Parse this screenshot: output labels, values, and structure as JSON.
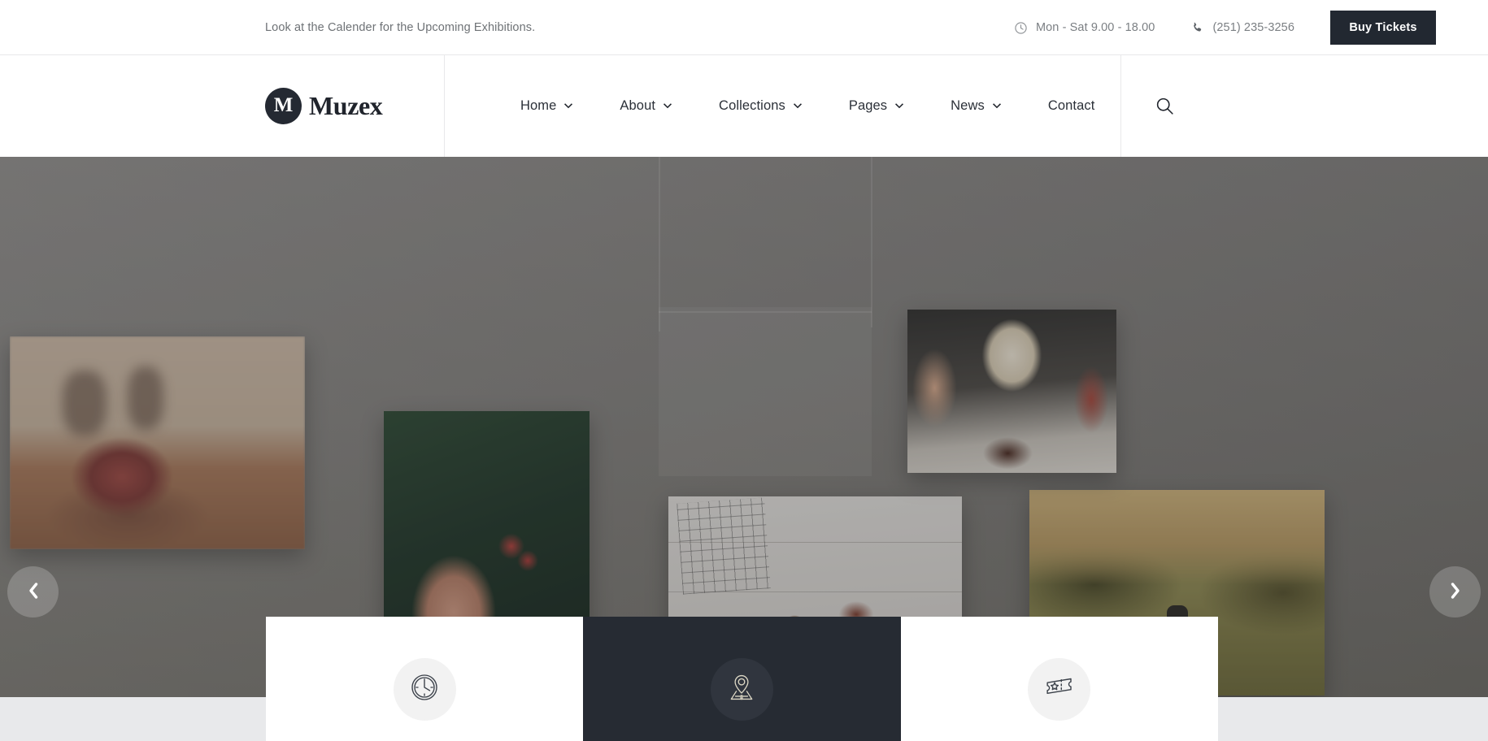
{
  "topbar": {
    "note": "Look at the Calender for the Upcoming Exhibitions.",
    "hours_icon": "clock-icon",
    "hours": "Mon - Sat 9.00 - 18.00",
    "phone_icon": "phone-icon",
    "phone": "(251) 235-3256",
    "buy_tickets_label": "Buy Tickets"
  },
  "header": {
    "logo_mark": "M",
    "logo_text": "Muzex",
    "nav": [
      {
        "label": "Home",
        "has_dropdown": true
      },
      {
        "label": "About",
        "has_dropdown": true
      },
      {
        "label": "Collections",
        "has_dropdown": true
      },
      {
        "label": "Pages",
        "has_dropdown": true
      },
      {
        "label": "News",
        "has_dropdown": true
      },
      {
        "label": "Contact",
        "has_dropdown": false
      }
    ],
    "search_icon": "search-icon",
    "menu_icon": "hamburger-menu-icon"
  },
  "hero": {
    "prev_icon": "chevron-left-icon",
    "next_icon": "chevron-right-icon",
    "slides_alt": [
      "coffee-cup-photo",
      "hand-holding-coffee-cherries-photo",
      "coffee-flatlay-photo",
      "mountain-landscape-photo",
      "pour-over-barista-photo"
    ]
  },
  "info_cards": [
    {
      "icon": "clock-icon",
      "theme": "light"
    },
    {
      "icon": "map-location-icon",
      "theme": "dark"
    },
    {
      "icon": "ticket-star-icon",
      "theme": "light"
    }
  ],
  "colors": {
    "dark": "#262b33",
    "button_dark": "#222831",
    "text_muted": "#7b7f83",
    "text_dark": "#20242c",
    "card_icon_bg_light": "#f2f2f2",
    "card_icon_bg_dark": "#30353e",
    "below_fold": "#e8e9eb"
  }
}
